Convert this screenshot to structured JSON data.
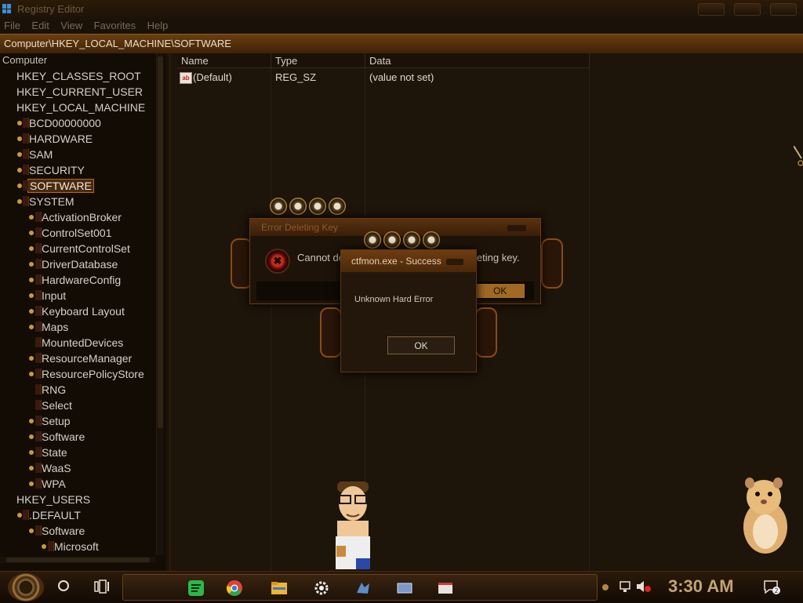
{
  "window": {
    "title": "Registry Editor"
  },
  "menu": [
    "File",
    "Edit",
    "View",
    "Favorites",
    "Help"
  ],
  "address": "Computer\\HKEY_LOCAL_MACHINE\\SOFTWARE",
  "tree": {
    "root": "Computer",
    "items": [
      {
        "label": "HKEY_CLASSES_ROOT",
        "level": 0,
        "expander": false,
        "selected": false
      },
      {
        "label": "HKEY_CURRENT_USER",
        "level": 0,
        "expander": false,
        "selected": false
      },
      {
        "label": "HKEY_LOCAL_MACHINE",
        "level": 0,
        "expander": false,
        "selected": false
      },
      {
        "label": "BCD00000000",
        "level": 1,
        "expander": true,
        "selected": false
      },
      {
        "label": "HARDWARE",
        "level": 1,
        "expander": true,
        "selected": false
      },
      {
        "label": "SAM",
        "level": 1,
        "expander": true,
        "selected": false
      },
      {
        "label": "SECURITY",
        "level": 1,
        "expander": true,
        "selected": false
      },
      {
        "label": "SOFTWARE",
        "level": 1,
        "expander": true,
        "selected": true
      },
      {
        "label": "SYSTEM",
        "level": 1,
        "expander": true,
        "selected": false
      },
      {
        "label": "ActivationBroker",
        "level": 2,
        "expander": true,
        "selected": false
      },
      {
        "label": "ControlSet001",
        "level": 2,
        "expander": true,
        "selected": false
      },
      {
        "label": "CurrentControlSet",
        "level": 2,
        "expander": true,
        "selected": false
      },
      {
        "label": "DriverDatabase",
        "level": 2,
        "expander": true,
        "selected": false
      },
      {
        "label": "HardwareConfig",
        "level": 2,
        "expander": true,
        "selected": false
      },
      {
        "label": "Input",
        "level": 2,
        "expander": true,
        "selected": false
      },
      {
        "label": "Keyboard Layout",
        "level": 2,
        "expander": true,
        "selected": false
      },
      {
        "label": "Maps",
        "level": 2,
        "expander": true,
        "selected": false
      },
      {
        "label": "MountedDevices",
        "level": 2,
        "expander": false,
        "selected": false
      },
      {
        "label": "ResourceManager",
        "level": 2,
        "expander": true,
        "selected": false
      },
      {
        "label": "ResourcePolicyStore",
        "level": 2,
        "expander": true,
        "selected": false
      },
      {
        "label": "RNG",
        "level": 2,
        "expander": false,
        "selected": false
      },
      {
        "label": "Select",
        "level": 2,
        "expander": false,
        "selected": false
      },
      {
        "label": "Setup",
        "level": 2,
        "expander": true,
        "selected": false
      },
      {
        "label": "Software",
        "level": 2,
        "expander": true,
        "selected": false
      },
      {
        "label": "State",
        "level": 2,
        "expander": true,
        "selected": false
      },
      {
        "label": "WaaS",
        "level": 2,
        "expander": true,
        "selected": false
      },
      {
        "label": "WPA",
        "level": 2,
        "expander": true,
        "selected": false
      },
      {
        "label": "HKEY_USERS",
        "level": 0,
        "expander": false,
        "selected": false
      },
      {
        "label": ".DEFAULT",
        "level": 1,
        "expander": true,
        "selected": false
      },
      {
        "label": "Software",
        "level": 2,
        "expander": true,
        "selected": false
      },
      {
        "label": "Microsoft",
        "level": 3,
        "expander": true,
        "selected": false
      }
    ]
  },
  "list": {
    "columns": [
      "Name",
      "Type",
      "Data"
    ],
    "rows": [
      {
        "name": "(Default)",
        "type": "REG_SZ",
        "data": "(value not set)",
        "icon": "string-value-icon"
      }
    ]
  },
  "error_dialog": {
    "title": "Error Deleting Key",
    "message": "Cannot de",
    "message_tail": "leting key.",
    "ok_label": "OK",
    "icon": "error-icon"
  },
  "success_dialog": {
    "title": "ctfmon.exe - Success",
    "message": "Unknown Hard Error",
    "ok_label": "OK"
  },
  "taskbar": {
    "clock": "3:30 AM",
    "notification_count": "2",
    "apps": [
      "spotify-icon",
      "chrome-icon",
      "file-explorer-icon",
      "settings-icon",
      "app-icon",
      "remote-desktop-icon",
      "window-icon"
    ]
  },
  "colors": {
    "accent": "#b06a20",
    "address_bar": "#6a3e10",
    "clock": "#c4a470",
    "error": "#c42a1a"
  }
}
